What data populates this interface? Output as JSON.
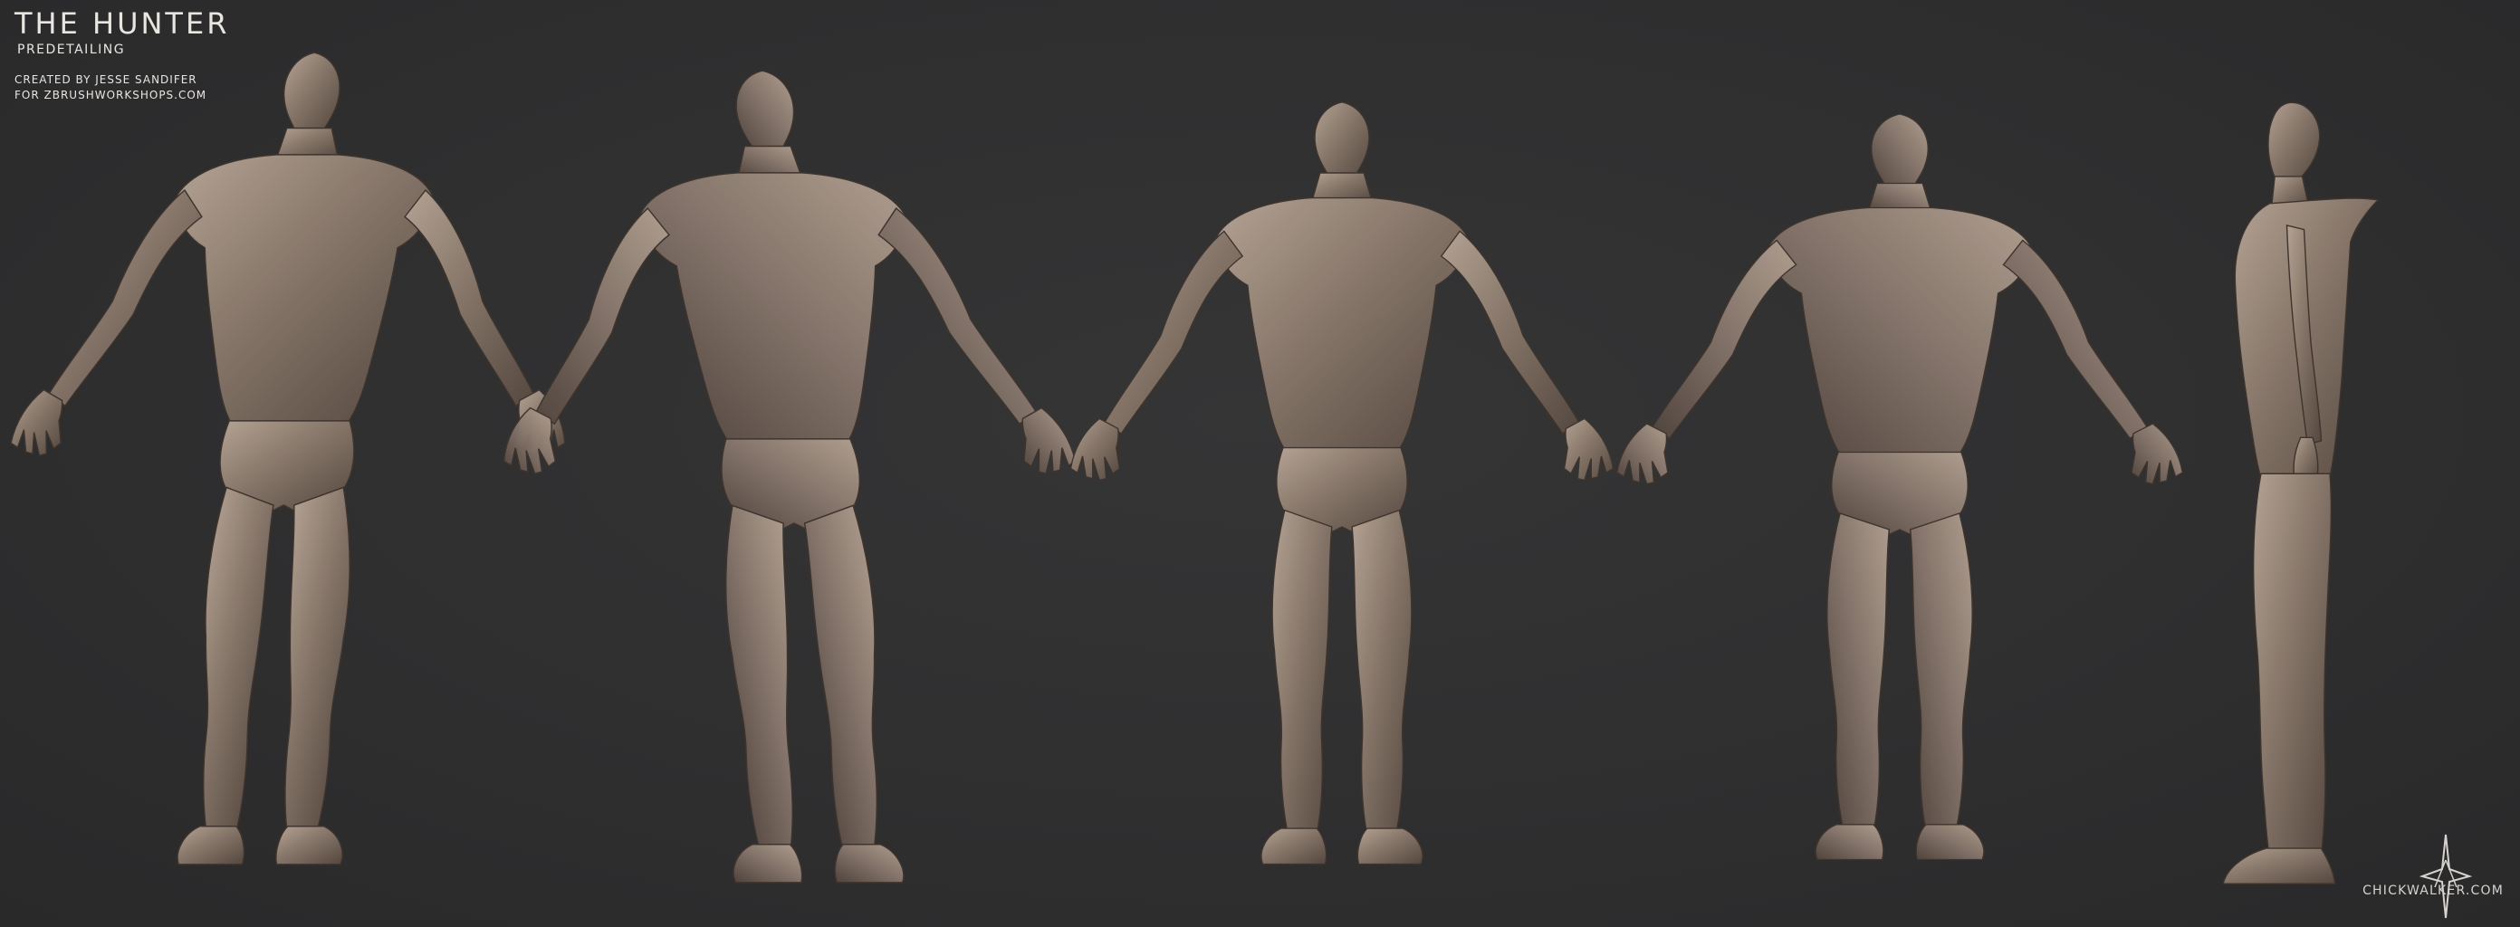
{
  "title": "THE HUNTER",
  "subtitle": "PREDETAILING",
  "credits": [
    "CREATED BY JESSE SANDIFER",
    "FOR ZBRUSHWORKSHOPS.COM"
  ],
  "watermark": "CHICKWALKER.COM",
  "views": [
    {
      "id": "three-quarter-front",
      "facing": "three-quarter front"
    },
    {
      "id": "three-quarter-back",
      "facing": "three-quarter back"
    },
    {
      "id": "front",
      "facing": "front"
    },
    {
      "id": "back",
      "facing": "back"
    },
    {
      "id": "side",
      "facing": "side"
    }
  ],
  "colors": {
    "background": "#2e2e2f",
    "clay": "#8a7a6e",
    "clay_highlight": "#c1b1a3",
    "clay_shadow": "#4d4038",
    "text": "#e9e6e1"
  }
}
